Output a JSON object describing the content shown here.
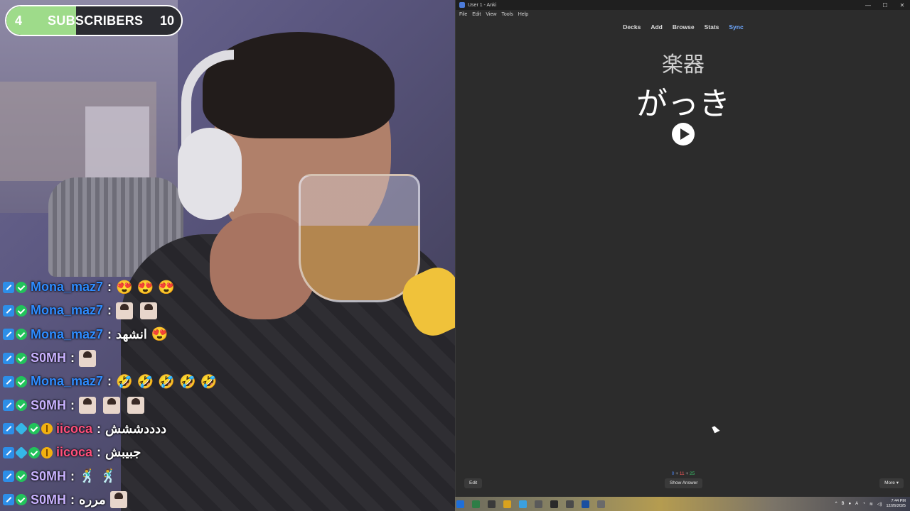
{
  "subscribers": {
    "current": "4",
    "label": "SUBSCRIBERS",
    "goal": "10",
    "progress": 0.4
  },
  "chat": [
    {
      "user": "Mona_maz7",
      "color": "#2f8cff",
      "badges": [
        "pen",
        "check"
      ],
      "text": "",
      "emotes": [
        "😍",
        "😍",
        "😍"
      ],
      "faces": 0
    },
    {
      "user": "Mona_maz7",
      "color": "#2f8cff",
      "badges": [
        "pen",
        "check"
      ],
      "text": "",
      "emotes": [],
      "faces": 2
    },
    {
      "user": "Mona_maz7",
      "color": "#2f8cff",
      "badges": [
        "pen",
        "check"
      ],
      "text": "انشهد",
      "emotes": [
        "😍"
      ],
      "faces": 0
    },
    {
      "user": "S0MH",
      "color": "#c9b2ff",
      "badges": [
        "pen",
        "check"
      ],
      "text": "",
      "emotes": [],
      "faces": 1
    },
    {
      "user": "Mona_maz7",
      "color": "#2f8cff",
      "badges": [
        "pen",
        "check"
      ],
      "text": "",
      "emotes": [
        "🤣",
        "🤣",
        "🤣",
        "🤣",
        "🤣"
      ],
      "faces": 0
    },
    {
      "user": "S0MH",
      "color": "#c9b2ff",
      "badges": [
        "pen",
        "check"
      ],
      "text": "",
      "emotes": [],
      "faces": 3
    },
    {
      "user": "iicoca",
      "color": "#ff4f7b",
      "badges": [
        "pen",
        "cube",
        "check",
        "gift"
      ],
      "text": "ددددششش",
      "emotes": [],
      "faces": 0
    },
    {
      "user": "iicoca",
      "color": "#ff4f7b",
      "badges": [
        "pen",
        "cube",
        "check",
        "gift"
      ],
      "text": "جبيبش",
      "emotes": [],
      "faces": 0
    },
    {
      "user": "S0MH",
      "color": "#c9b2ff",
      "badges": [
        "pen",
        "check"
      ],
      "text": "",
      "emotes": [
        "🕺",
        "🕺"
      ],
      "faces": 0
    },
    {
      "user": "S0MH",
      "color": "#c9b2ff",
      "badges": [
        "pen",
        "check"
      ],
      "text": "مرره",
      "emotes": [],
      "faces": 1
    }
  ],
  "anki": {
    "window_title": "User 1 - Anki",
    "menu": [
      "File",
      "Edit",
      "View",
      "Tools",
      "Help"
    ],
    "toolbar": {
      "decks": "Decks",
      "add": "Add",
      "browse": "Browse",
      "stats": "Stats",
      "sync": "Sync"
    },
    "card": {
      "front": "楽器",
      "reading": "がっき"
    },
    "counts": {
      "new": "0",
      "learning": "11",
      "review": "25",
      "plus": "+"
    },
    "buttons": {
      "edit": "Edit",
      "show_answer": "Show Answer",
      "more": "More ▾"
    }
  },
  "taskbar": {
    "icon_colors": [
      "#1e6fd9",
      "#2e7d46",
      "#3a3a3a",
      "#d9a21e",
      "#3aa0e0",
      "#5a5a5a",
      "#2a2a2a",
      "#4a4a4a",
      "#1a4fa0",
      "#6a6a6a"
    ],
    "clock_time": "7:44 PM",
    "clock_date": "12/26/2025"
  }
}
